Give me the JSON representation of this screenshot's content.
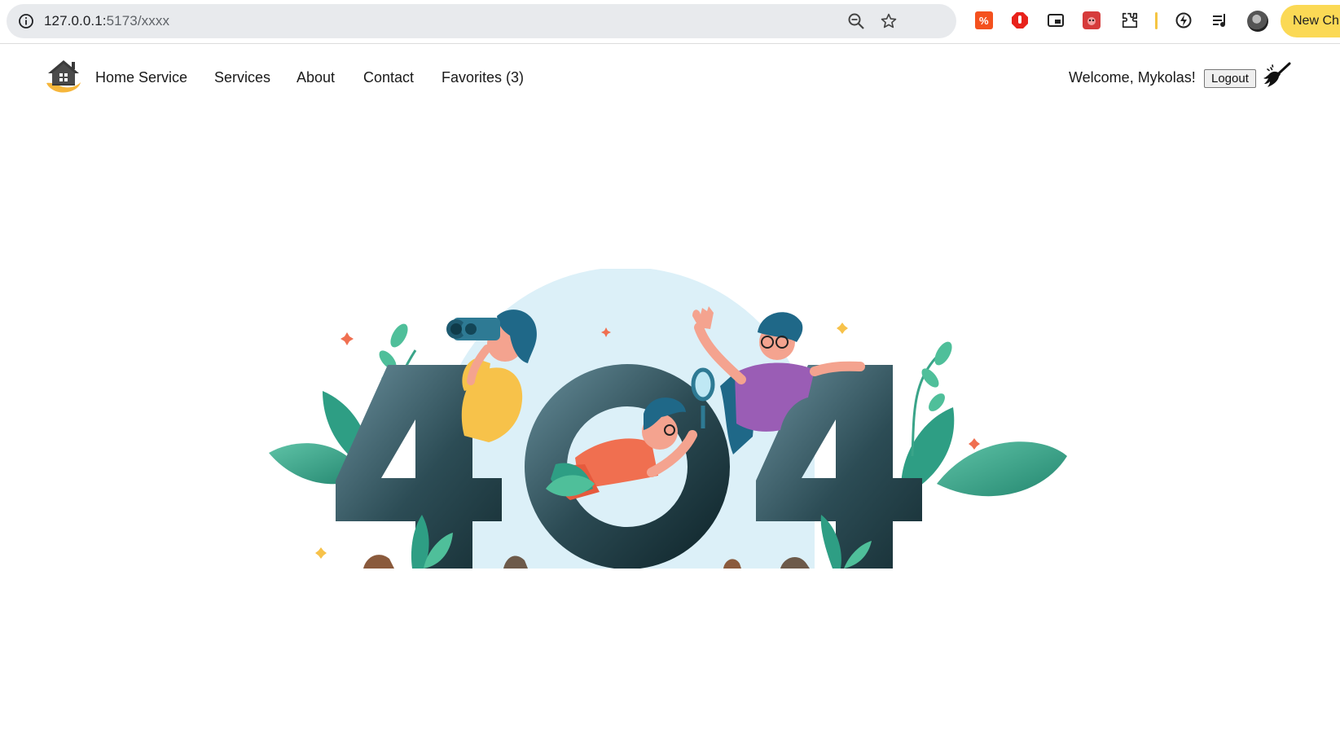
{
  "browser": {
    "url_host": "127.0.0.1:",
    "url_path": "5173/xxxx",
    "new_chrome_label": "New Chr",
    "icons": [
      "site-info-icon",
      "zoom-icon",
      "bookmark-star-icon",
      "extension-icons",
      "profile-avatar"
    ]
  },
  "navbar": {
    "brand": "Home Service",
    "links": [
      "Services",
      "About",
      "Contact",
      "Favorites (3)"
    ],
    "welcome": "Welcome, Mykolas!",
    "logout_label": "Logout"
  },
  "main": {
    "illustration": "404-illustration",
    "illustration_text": "404"
  },
  "colors": {
    "digit_dark": "#213c43",
    "digit_light": "#5f8592",
    "circle_bg": "#dcf0f8",
    "leaf": "#2e9e84",
    "accent_yellow": "#f7c24a",
    "accent_orange": "#f06f50",
    "accent_purple": "#9a5db5"
  }
}
